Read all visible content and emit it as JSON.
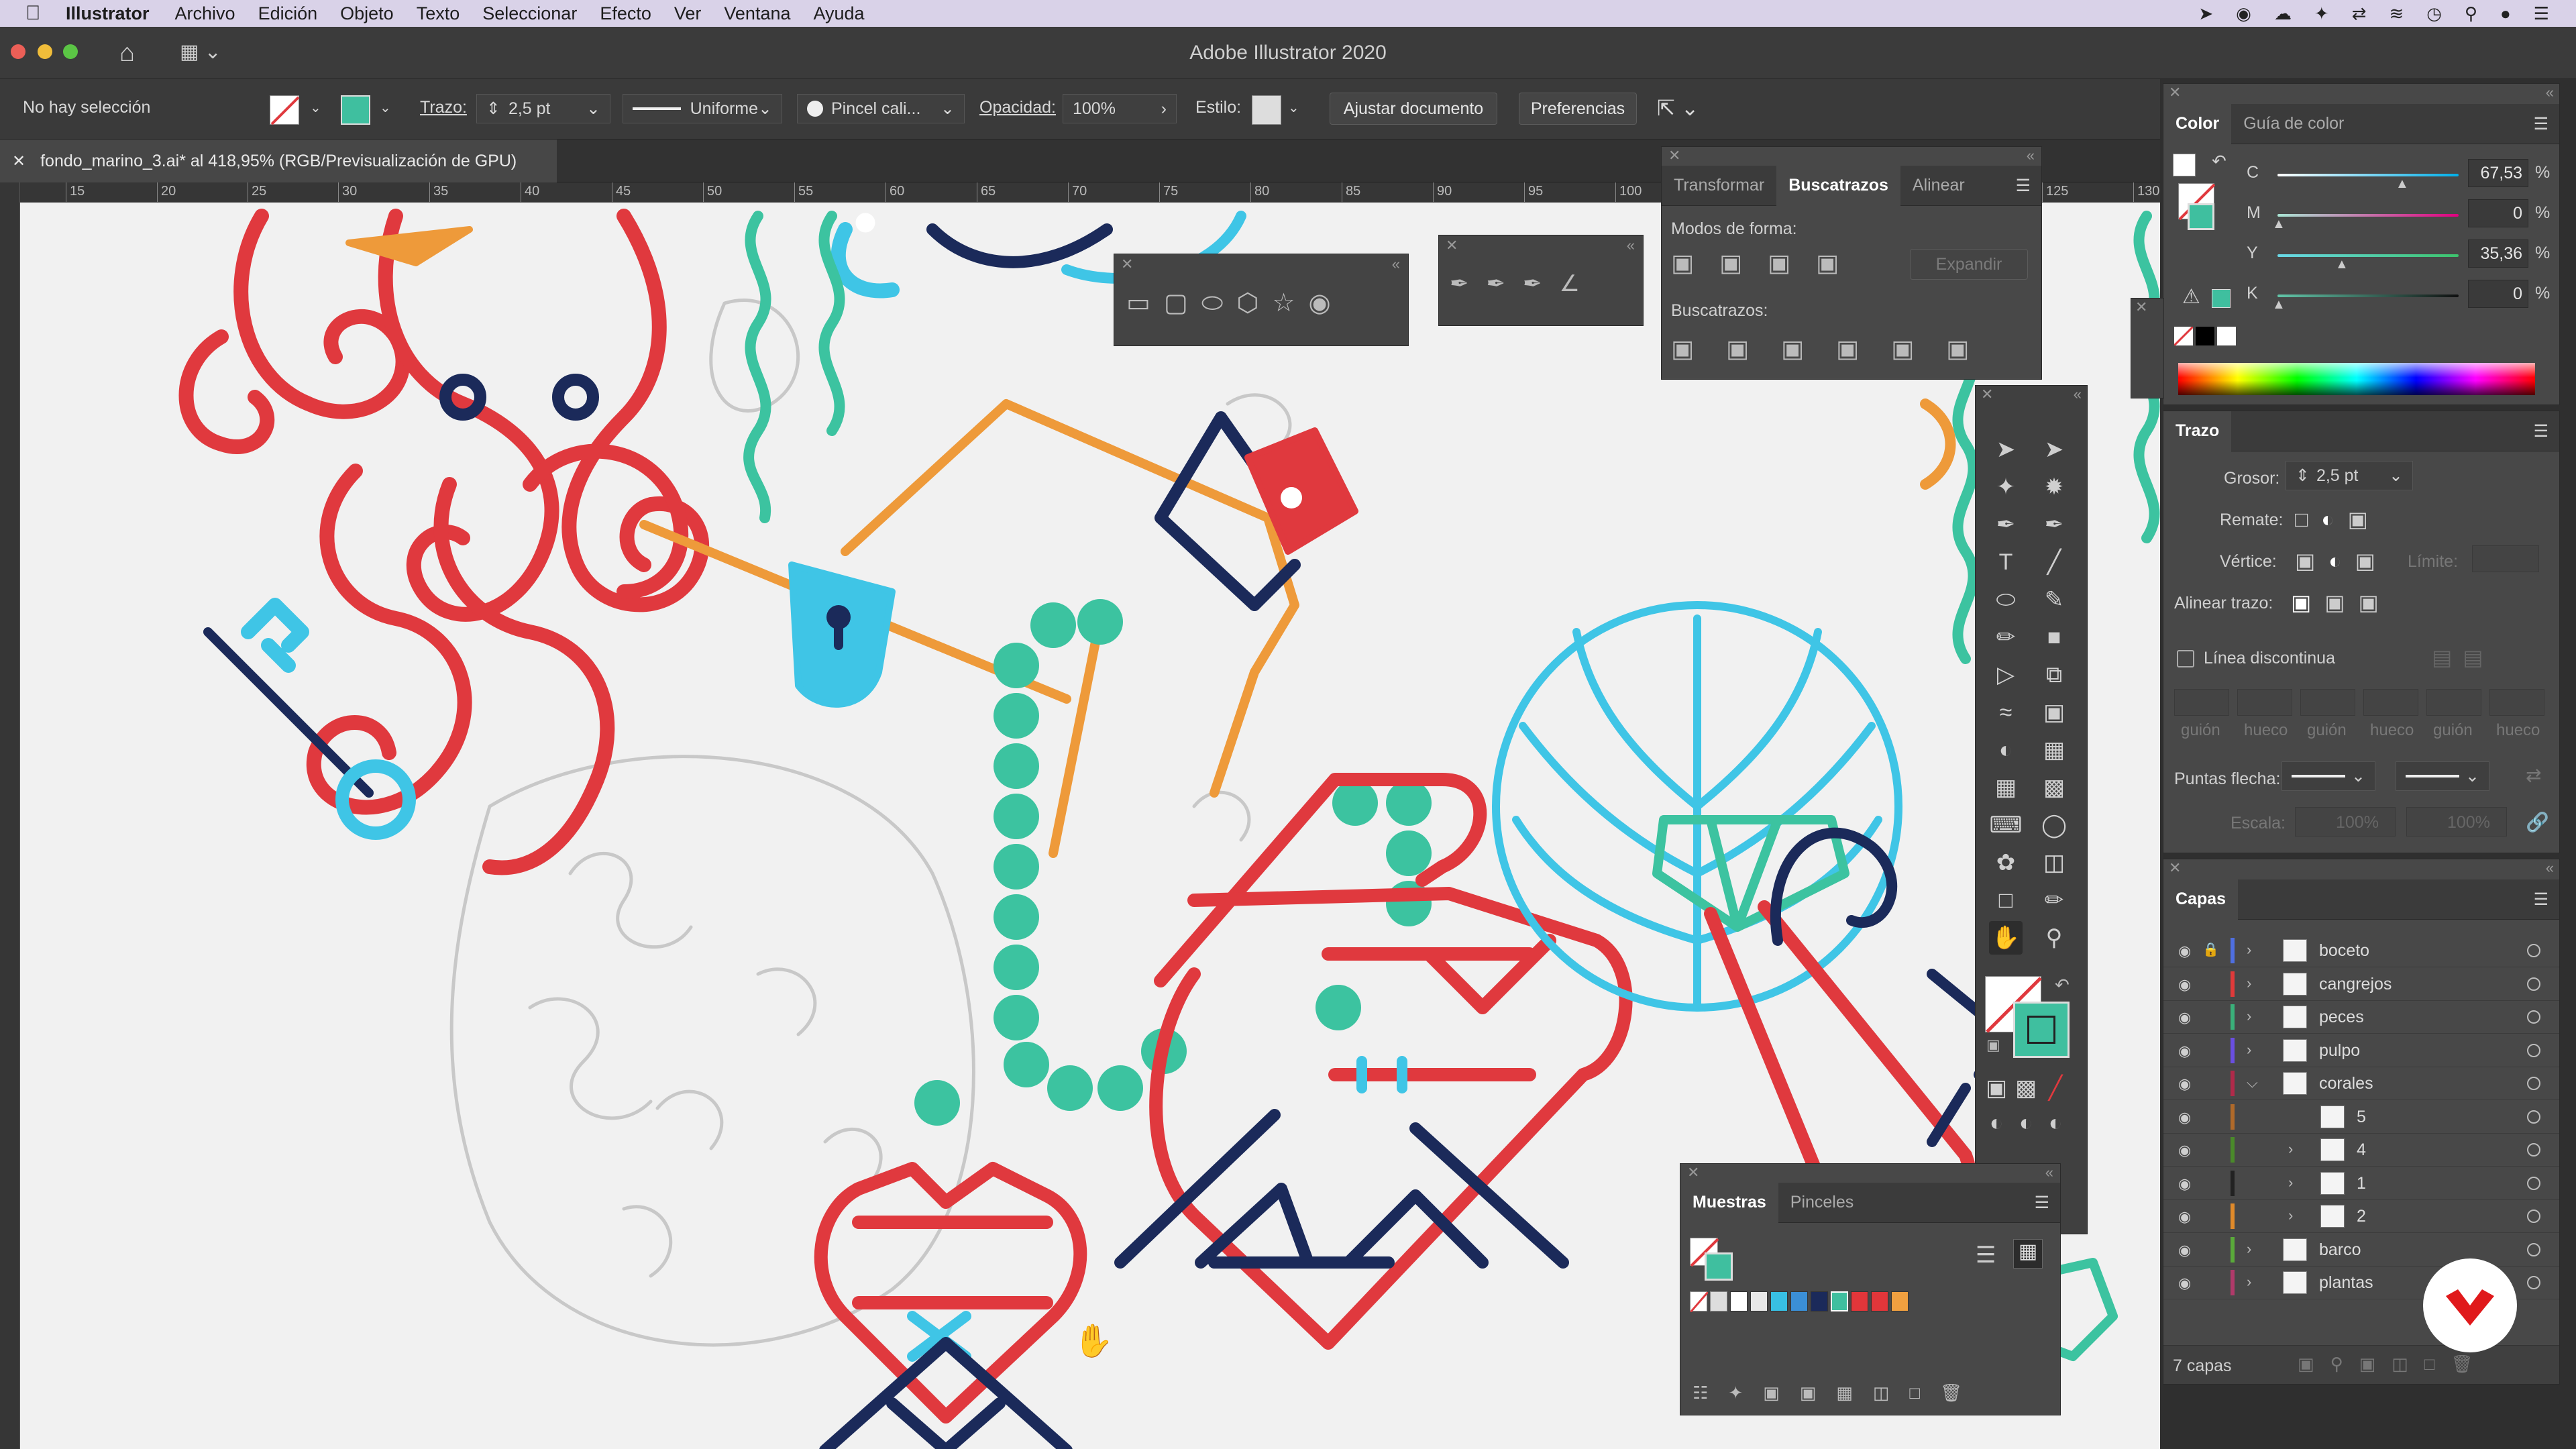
{
  "menubar": {
    "apple": "",
    "app": "Illustrator",
    "items": [
      "Archivo",
      "Edición",
      "Objeto",
      "Texto",
      "Seleccionar",
      "Efecto",
      "Ver",
      "Ventana",
      "Ayuda"
    ]
  },
  "window": {
    "title": "Adobe Illustrator 2020"
  },
  "control": {
    "selection": "No hay selección",
    "stroke_label": "Trazo:",
    "stroke_value": "2,5 pt",
    "profile": "Uniforme",
    "brush": "Pincel cali...",
    "opacity_label": "Opacidad:",
    "opacity_value": "100%",
    "style_label": "Estilo:",
    "fit_button": "Ajustar documento",
    "prefs_button": "Preferencias"
  },
  "document_tab": {
    "label": "fondo_marino_3.ai* al 418,95% (RGB/Previsualización de GPU)"
  },
  "ruler_top": [
    "15",
    "20",
    "25",
    "30",
    "35",
    "40",
    "45",
    "50",
    "55",
    "60",
    "65",
    "70",
    "75",
    "80",
    "85",
    "90",
    "95",
    "100",
    "125",
    "130"
  ],
  "pathfinder": {
    "tabs": [
      "Transformar",
      "Buscatrazos",
      "Alinear"
    ],
    "modes_label": "Modos de forma:",
    "expand_label": "Expandir",
    "pathfinders_label": "Buscatrazos:"
  },
  "color_panel": {
    "tabs": [
      "Color",
      "Guía de color"
    ],
    "channels": [
      {
        "label": "C",
        "value": "67,53",
        "pct": "%",
        "fraction": 0.6753
      },
      {
        "label": "M",
        "value": "0",
        "pct": "%",
        "fraction": 0
      },
      {
        "label": "Y",
        "value": "35,36",
        "pct": "%",
        "fraction": 0.3536
      },
      {
        "label": "K",
        "value": "0",
        "pct": "%",
        "fraction": 0
      }
    ]
  },
  "stroke_panel": {
    "title": "Trazo",
    "weight_label": "Grosor:",
    "weight_value": "2,5 pt",
    "cap_label": "Remate:",
    "corner_label": "Vértice:",
    "limit_label": "Límite:",
    "align_label": "Alinear trazo:",
    "dashed_label": "Línea discontinua",
    "dash_labels": [
      "guión",
      "hueco",
      "guión",
      "hueco",
      "guión",
      "hueco"
    ],
    "arrow_label": "Puntas flecha:",
    "scale_label": "Escala:",
    "scale_values": [
      "100%",
      "100%"
    ]
  },
  "layers_panel": {
    "title": "Capas",
    "layers": [
      {
        "name": "boceto",
        "color": "#4f6fe0",
        "locked": true,
        "expanded": false
      },
      {
        "name": "cangrejos",
        "color": "#e03a3a",
        "locked": false,
        "expanded": false
      },
      {
        "name": "peces",
        "color": "#3ab07a",
        "locked": false,
        "expanded": false
      },
      {
        "name": "pulpo",
        "color": "#6a4fe0",
        "locked": false,
        "expanded": false
      },
      {
        "name": "corales",
        "color": "#b02a4a",
        "locked": false,
        "expanded": true
      },
      {
        "name": "5",
        "color": "#b06a2a",
        "sub": true
      },
      {
        "name": "4",
        "color": "#4a8a2a",
        "sub": true
      },
      {
        "name": "1",
        "color": "#222222",
        "sub": true
      },
      {
        "name": "2",
        "color": "#e08a2a",
        "sub": true
      },
      {
        "name": "barco",
        "color": "#5aaa3a",
        "locked": false,
        "expanded": false
      },
      {
        "name": "plantas",
        "color": "#b03a6a",
        "locked": false,
        "expanded": false
      }
    ],
    "count": "7 capas"
  },
  "swatches_panel": {
    "tabs": [
      "Muestras",
      "Pinceles"
    ],
    "swatches": [
      "#ffffff",
      "#e8e8e8",
      "#38bfe3",
      "#3b8fd6",
      "#1b2a5a",
      "#3fbf9f",
      "#e2363a",
      "#e2363a",
      "#f0a040"
    ]
  },
  "colors": {
    "red": "#e0393e",
    "navy": "#1b2a5a",
    "teal": "#3cc3a0",
    "cyan": "#3fc5e6",
    "orange": "#ee9a3a",
    "sketch": "#c5c5c5"
  }
}
